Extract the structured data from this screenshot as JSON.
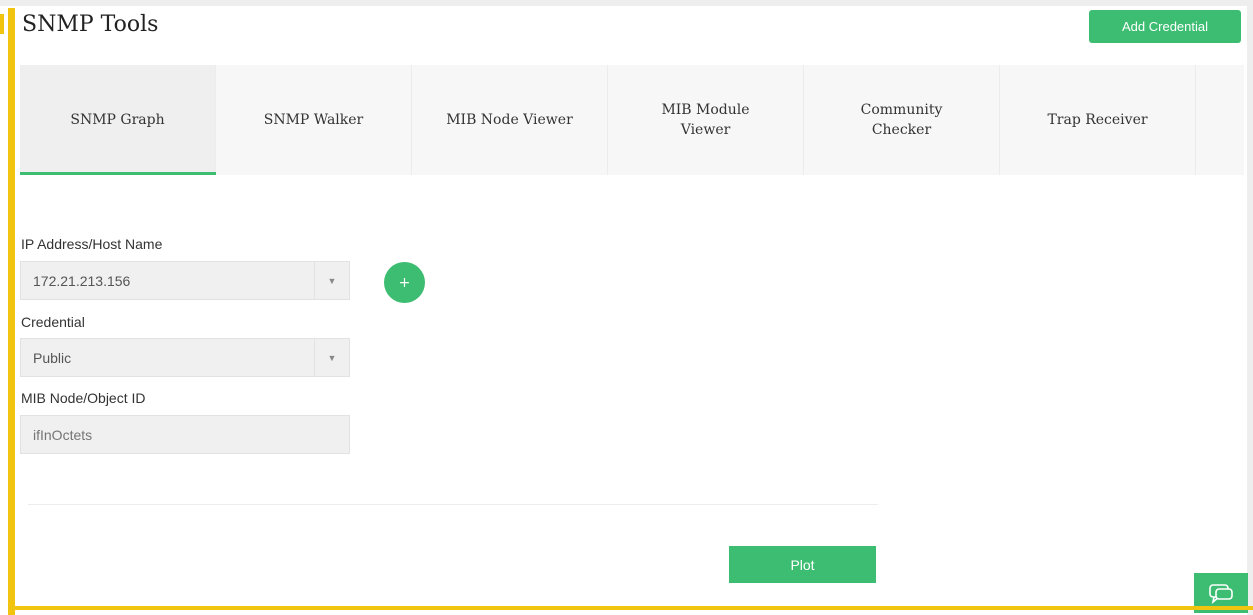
{
  "header": {
    "title": "SNMP Tools",
    "add_credential_label": "Add Credential"
  },
  "tabs": [
    {
      "label": "SNMP Graph",
      "active": true
    },
    {
      "label": "SNMP Walker",
      "active": false
    },
    {
      "label": "MIB Node Viewer",
      "active": false
    },
    {
      "label": "MIB Module Viewer",
      "active": false
    },
    {
      "label": "Community Checker",
      "active": false
    },
    {
      "label": "Trap Receiver",
      "active": false
    }
  ],
  "form": {
    "ip_label": "IP Address/Host Name",
    "ip_value": "172.21.213.156",
    "credential_label": "Credential",
    "credential_value": "Public",
    "mib_label": "MIB Node/Object ID",
    "mib_placeholder": "ifInOctets",
    "add_host_icon": "plus-icon"
  },
  "actions": {
    "plot_label": "Plot",
    "chat_icon": "chat-icon"
  },
  "colors": {
    "accent": "#3dbd72",
    "border_accent": "#f1c40f"
  }
}
